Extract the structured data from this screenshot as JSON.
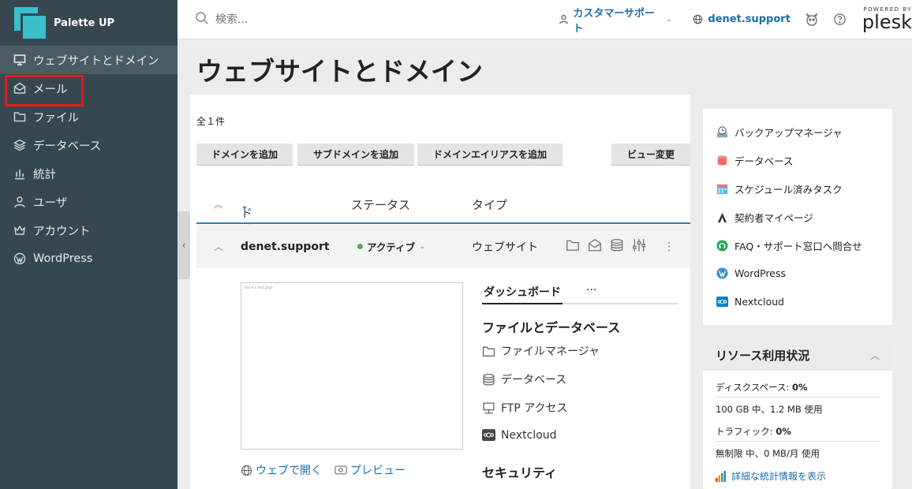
{
  "brand": {
    "name": "Palette UP"
  },
  "sidebar": {
    "items": [
      {
        "label": "ウェブサイトとドメイン",
        "icon": "monitor-icon"
      },
      {
        "label": "メール",
        "icon": "mail-icon"
      },
      {
        "label": "ファイル",
        "icon": "folder-icon"
      },
      {
        "label": "データベース",
        "icon": "layers-icon"
      },
      {
        "label": "統計",
        "icon": "bar-chart-icon"
      },
      {
        "label": "ユーザ",
        "icon": "user-icon"
      },
      {
        "label": "アカウント",
        "icon": "crown-icon"
      },
      {
        "label": "WordPress",
        "icon": "wordpress-icon"
      }
    ]
  },
  "topbar": {
    "search_placeholder": "検索...",
    "support_label": "カスタマーサポート",
    "domain": "denet.support",
    "plesk_powered": "POWERED BY",
    "plesk_logo": "plesk"
  },
  "page": {
    "title": "ウェブサイトとドメイン"
  },
  "main": {
    "count": "全１件",
    "buttons": [
      "ドメインを追加",
      "サブドメインを追加",
      "ドメインエイリアスを追加",
      "ビュー変更"
    ],
    "columns": {
      "name": "ドメイン名",
      "status": "ステータス",
      "type": "タイプ"
    },
    "row": {
      "domain": "denet.support",
      "status": "アクティブ",
      "type": "ウェブサイト"
    },
    "preview_tiny": "This is a test page",
    "open_web": "ウェブで開く",
    "preview": "プレビュー",
    "tabs": {
      "dashboard": "ダッシュボード",
      "more": "···"
    },
    "section_files": "ファイルとデータベース",
    "tools": [
      "ファイルマネージャ",
      "データベース",
      "FTP アクセス",
      "Nextcloud"
    ],
    "section_security": "セキュリティ"
  },
  "right_panel": {
    "items": [
      "バックアップマネージャ",
      "データベース",
      "スケジュール済みタスク",
      "契約者マイページ",
      "FAQ・サポート窓口へ問合せ",
      "WordPress",
      "Nextcloud"
    ]
  },
  "resources": {
    "title": "リソース利用状況",
    "disk_label": "ディスクスペース: ",
    "disk_value": "0%",
    "disk_detail": "100 GB 中、1.2 MB 使用",
    "traffic_label": "トラフィック: ",
    "traffic_value": "0%",
    "traffic_detail": "無制限 中、0 MB/月 使用",
    "stats_link": "詳細な統計情報を表示"
  },
  "colors": {
    "sidebar_bg": "#37474f",
    "accent": "#1b6fa8",
    "brand_teal": "#39c0c8",
    "highlight_red": "#e01d1d",
    "status_green": "#4caf50"
  }
}
